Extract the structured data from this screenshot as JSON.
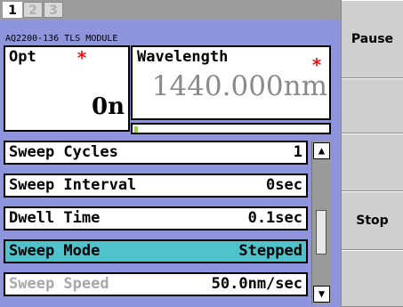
{
  "tabs": [
    "1",
    "2",
    "3"
  ],
  "module_title": "AQ2200-136 TLS MODULE",
  "opt": {
    "label": "Opt",
    "star": "*",
    "value": "0n"
  },
  "wavelength": {
    "label": "Wavelength",
    "star": "*",
    "value": "1440.000nm"
  },
  "list": [
    {
      "label": "Sweep Cycles",
      "value": "1"
    },
    {
      "label": "Sweep Interval",
      "value": "0sec"
    },
    {
      "label": "Dwell Time",
      "value": "0.1sec"
    },
    {
      "label": "Sweep Mode",
      "value": "Stepped"
    },
    {
      "label": "Sweep Speed",
      "value": "50.0nm/sec"
    }
  ],
  "scroll_icons": {
    "up": "triangle-up-icon",
    "down": "triangle-down-icon"
  },
  "softkeys": [
    "Pause",
    "",
    "",
    "Stop",
    ""
  ],
  "colors": {
    "selected_row": "#4fc2cc",
    "panel": "#8e95dc",
    "required_star": "#e31818"
  }
}
